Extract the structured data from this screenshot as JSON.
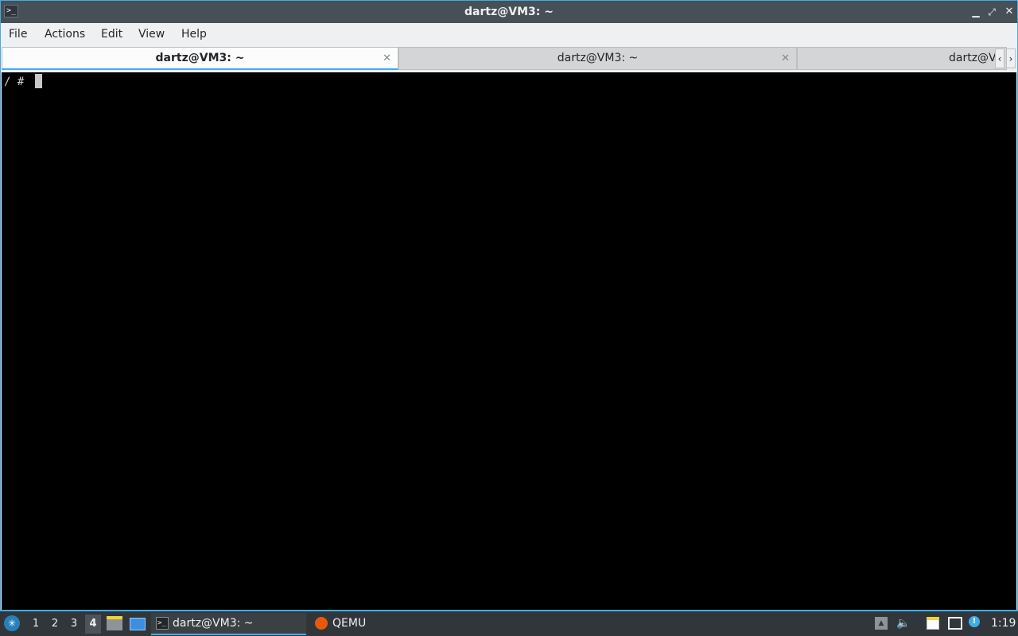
{
  "window": {
    "title": "dartz@VM3: ~",
    "app_icon_glyph": ">_",
    "minimize_glyph": "▁",
    "maximize_glyph": "⤢",
    "close_glyph": "✕"
  },
  "menubar": {
    "items": [
      {
        "label": "File"
      },
      {
        "label": "Actions"
      },
      {
        "label": "Edit"
      },
      {
        "label": "View"
      },
      {
        "label": "Help"
      }
    ]
  },
  "tabs": [
    {
      "label": "dartz@VM3: ~",
      "active": true,
      "close_glyph": "✕"
    },
    {
      "label": "dartz@VM3: ~",
      "active": false,
      "close_glyph": "✕"
    },
    {
      "label": "dartz@V",
      "active": false
    }
  ],
  "tab_scroll": {
    "left_glyph": "‹",
    "right_glyph": "›"
  },
  "terminal": {
    "prompt": "/ # ",
    "background": "#000000"
  },
  "taskbar": {
    "start_icon": "lxqt-icon",
    "start_glyph": "✳",
    "desktops": [
      "1",
      "2",
      "3",
      "4"
    ],
    "current_desktop": "4",
    "tasks": [
      {
        "label": "dartz@VM3: ~",
        "icon": "terminal-icon",
        "icon_glyph": ">_",
        "active": true
      },
      {
        "label": "QEMU",
        "icon": "qemu-icon",
        "active": false
      }
    ],
    "tray": {
      "volume_glyph": "🔈",
      "info_glyph": "!",
      "clock": "1:19"
    }
  },
  "colors": {
    "accent": "#3daee9",
    "titlebar": "#475057",
    "panel": "#31363b"
  }
}
